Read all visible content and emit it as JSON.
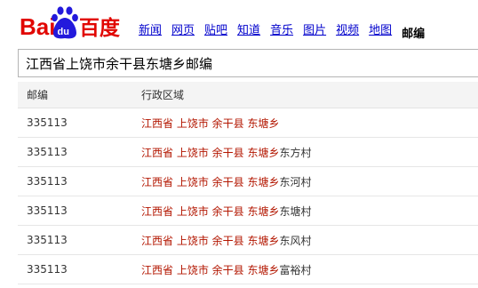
{
  "logo": {
    "text_left": "Bai",
    "text_paw": "du",
    "text_right": "百度",
    "colors": {
      "red": "#e10601",
      "blue": "#2319dc"
    }
  },
  "nav": {
    "items": [
      {
        "label": "新闻"
      },
      {
        "label": "网页"
      },
      {
        "label": "贴吧"
      },
      {
        "label": "知道"
      },
      {
        "label": "音乐"
      },
      {
        "label": "图片"
      },
      {
        "label": "视频"
      },
      {
        "label": "地图"
      }
    ],
    "current": "邮编"
  },
  "search": {
    "value": "江西省上饶市余干县东塘乡邮编"
  },
  "table": {
    "headers": {
      "code": "邮编",
      "area": "行政区域"
    },
    "rows": [
      {
        "code": "335113",
        "region": "江西省 上饶市 余干县 东塘乡",
        "village": ""
      },
      {
        "code": "335113",
        "region": "江西省 上饶市 余干县 东塘乡",
        "village": "东方村"
      },
      {
        "code": "335113",
        "region": "江西省 上饶市 余干县 东塘乡",
        "village": "东河村"
      },
      {
        "code": "335113",
        "region": "江西省 上饶市 余干县 东塘乡",
        "village": "东塘村"
      },
      {
        "code": "335113",
        "region": "江西省 上饶市 余干县 东塘乡",
        "village": "东风村"
      },
      {
        "code": "335113",
        "region": "江西省 上饶市 余干县 东塘乡",
        "village": "富裕村"
      }
    ]
  }
}
